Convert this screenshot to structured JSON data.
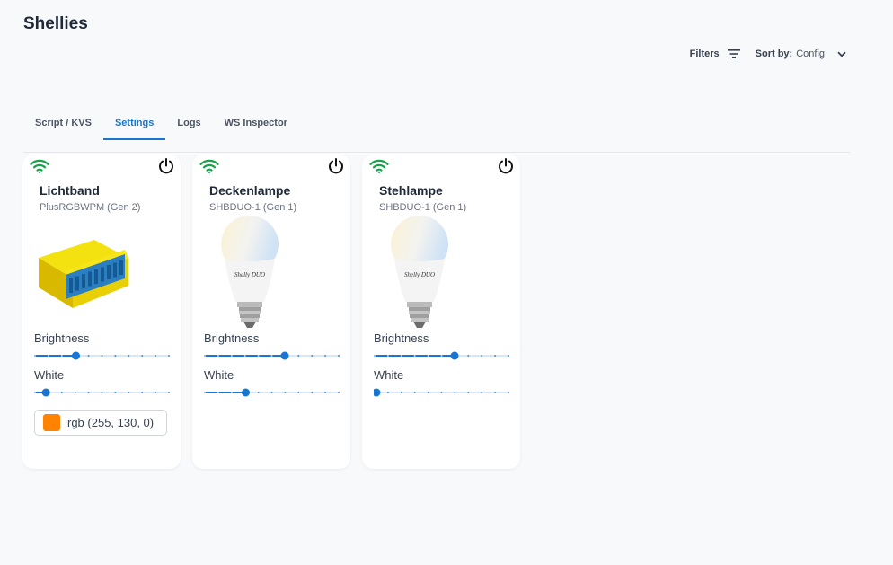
{
  "page": {
    "title": "Shellies"
  },
  "toolbar": {
    "filters_label": "Filters",
    "sort_label": "Sort by:",
    "sort_value": "Config"
  },
  "tabs": [
    {
      "label": "Script / KVS",
      "active": false
    },
    {
      "label": "Settings",
      "active": true
    },
    {
      "label": "Logs",
      "active": false
    },
    {
      "label": "WS Inspector",
      "active": false
    }
  ],
  "colors": {
    "accent": "#1976d2",
    "wifi": "#16a34a",
    "rgb_swatch": "#ff8200"
  },
  "devices": [
    {
      "name": "Lichtband",
      "model": "PlusRGBWPM (Gen 2)",
      "image": "rgbw-module",
      "brightness_label": "Brightness",
      "brightness": 0.3,
      "white_label": "White",
      "white": 0.07,
      "rgb_label": "rgb (255, 130, 0)",
      "rgb_color": "#ff8200"
    },
    {
      "name": "Deckenlampe",
      "model": "SHBDUO-1 (Gen 1)",
      "image": "duo-bulb",
      "brightness_label": "Brightness",
      "brightness": 0.6,
      "white_label": "White",
      "white": 0.3
    },
    {
      "name": "Stehlampe",
      "model": "SHBDUO-1 (Gen 1)",
      "image": "duo-bulb",
      "brightness_label": "Brightness",
      "brightness": 0.6,
      "white_label": "White",
      "white": 0.0
    }
  ],
  "bulb_brand": "Shelly",
  "bulb_model": "DUO"
}
